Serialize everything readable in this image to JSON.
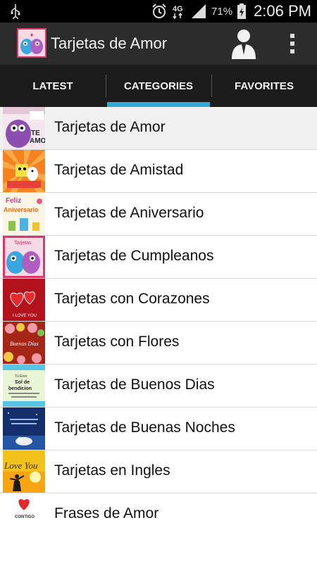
{
  "status_bar": {
    "icons": [
      "usb-icon",
      "alarm-icon",
      "signal-4g-icon",
      "signal-bars-icon",
      "battery-icon"
    ],
    "network": "4G",
    "battery_percent": "71%",
    "time": "2:06 PM"
  },
  "action_bar": {
    "title": "Tarjetas de Amor",
    "icons": [
      "app-logo-icon",
      "user-profile-icon",
      "overflow-menu-icon"
    ]
  },
  "tabs": [
    {
      "label": "LATEST",
      "active": false
    },
    {
      "label": "CATEGORIES",
      "active": true
    },
    {
      "label": "FAVORITES",
      "active": false
    }
  ],
  "categories": [
    {
      "label": "Tarjetas de Amor",
      "thumb": "purple-monster-card",
      "thumb_text": "TE AMO!"
    },
    {
      "label": "Tarjetas de Amistad",
      "thumb": "friendship-card"
    },
    {
      "label": "Tarjetas de Aniversario",
      "thumb": "anniversary-card",
      "thumb_text": "Feliz Aniversario"
    },
    {
      "label": "Tarjetas de Cumpleanos",
      "thumb": "monsters-card",
      "thumb_text": "Tarjetas"
    },
    {
      "label": "Tarjetas con Corazones",
      "thumb": "hearts-card",
      "thumb_text": "I LOVE YOU"
    },
    {
      "label": "Tarjetas con Flores",
      "thumb": "flowers-card",
      "thumb_text": "Buenos Días"
    },
    {
      "label": "Tarjetas de Buenos Dias",
      "thumb": "good-morning-card",
      "thumb_text": "Sol de bendicion"
    },
    {
      "label": "Tarjetas de Buenas Noches",
      "thumb": "good-night-card"
    },
    {
      "label": "Tarjetas en Ingles",
      "thumb": "english-card",
      "thumb_text": "Love You"
    },
    {
      "label": "Frases de Amor",
      "thumb": "phrases-card",
      "thumb_text": "CONTIGO TODO ES"
    }
  ],
  "colors": {
    "status_bar_bg": "#000000",
    "action_bar_bg": "#2c2c2c",
    "tab_bar_bg": "#1b1b1b",
    "tab_indicator": "#34a7d6",
    "row_selected_bg": "#f0f0f0"
  }
}
